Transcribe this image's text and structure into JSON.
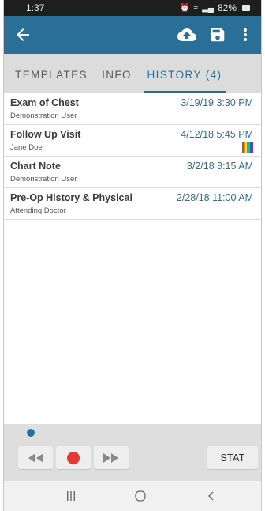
{
  "status_bar": {
    "time": "1:37",
    "battery": "82%",
    "icons": [
      "alarm-icon",
      "wifi-icon",
      "signal-icon",
      "battery-icon"
    ]
  },
  "app_bar": {
    "icons": [
      "back-arrow-icon",
      "cloud-upload-icon",
      "save-icon",
      "more-vertical-icon"
    ]
  },
  "tabs": [
    {
      "label": "TEMPLATES",
      "selected": false
    },
    {
      "label": "INFO",
      "selected": false
    },
    {
      "label": "HISTORY (4)",
      "selected": true
    }
  ],
  "history": [
    {
      "title": "Exam of Chest",
      "author": "Demonstration User",
      "date": "3/19/19 3:30 PM",
      "badge": false
    },
    {
      "title": "Follow Up Visit",
      "author": "Jane Doe",
      "date": "4/12/18 5:45 PM",
      "badge": true
    },
    {
      "title": "Chart Note",
      "author": "Demonstration User",
      "date": "3/2/18 8:15 AM",
      "badge": false
    },
    {
      "title": "Pre-Op History & Physical",
      "author": "Attending Doctor",
      "date": "2/28/18 11:00 AM",
      "badge": false
    }
  ],
  "player": {
    "progress": 0.0,
    "buttons": [
      "rewind-icon",
      "record-icon",
      "fast-forward-icon"
    ],
    "stat_label": "STAT"
  },
  "nav_bar": {
    "icons": [
      "recent-apps-icon",
      "home-icon",
      "back-icon"
    ]
  },
  "colors": {
    "primary": "#2a6f97",
    "record": "#e53935",
    "tab_bg": "#dcdcdc"
  }
}
